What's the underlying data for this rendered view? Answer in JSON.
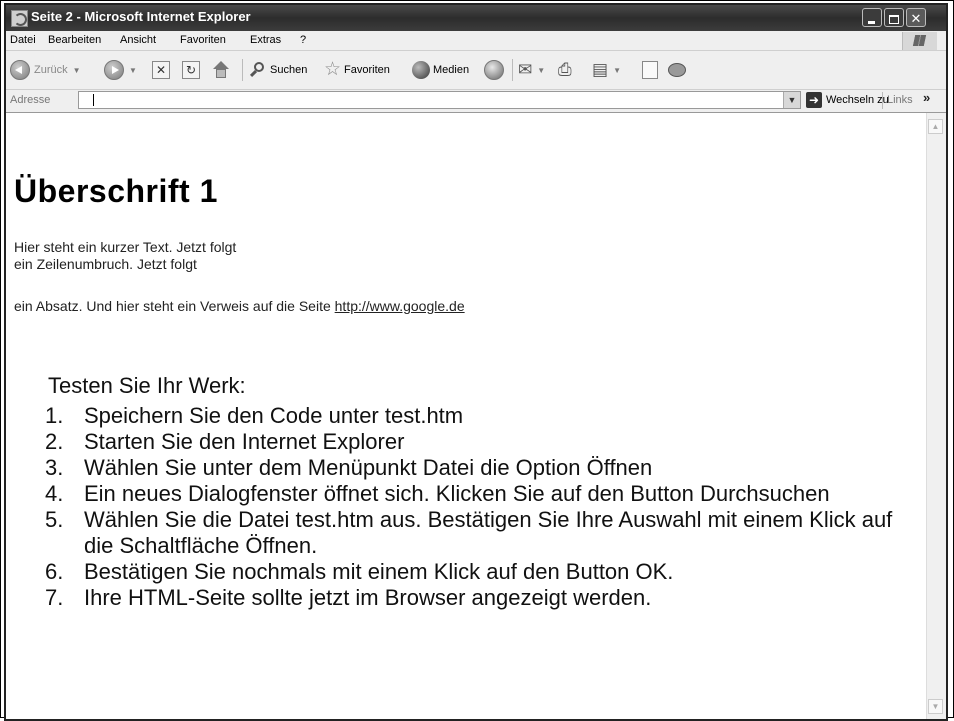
{
  "window": {
    "title": "Seite 2 - Microsoft Internet Explorer"
  },
  "menu": {
    "items": [
      "Datei",
      "Bearbeiten",
      "Ansicht",
      "Favoriten",
      "Extras",
      "?"
    ]
  },
  "toolbar": {
    "back_label": "Zurück",
    "search_label": "Suchen",
    "favorites_label": "Favoriten",
    "media_label": "Medien"
  },
  "address": {
    "label": "Adresse",
    "value": "",
    "go_label": "Wechseln zu",
    "links_label": "Links"
  },
  "page": {
    "heading": "Überschrift 1",
    "line1": "Hier steht ein kurzer Text. Jetzt folgt",
    "line2": "ein Zeilenumbruch. Jetzt folgt",
    "para_text": "ein Absatz. Und hier steht ein Verweis auf die Seite ",
    "link_text": "http://www.google.de"
  },
  "instructions": {
    "heading": "Testen Sie Ihr Werk:",
    "steps": [
      {
        "num": "1.",
        "text": "Speichern Sie den Code unter test.htm"
      },
      {
        "num": "2.",
        "text": "Starten Sie den Internet Explorer"
      },
      {
        "num": "3.",
        "text": "Wählen Sie unter dem Menüpunkt Datei die Option Öffnen"
      },
      {
        "num": "4.",
        "text": "Ein neues Dialogfenster öffnet sich. Klicken Sie auf den Button Durchsuchen"
      },
      {
        "num": "5.",
        "text": "Wählen Sie die Datei test.htm aus. Bestätigen Sie Ihre Auswahl mit einem Klick auf die Schaltfläche Öffnen."
      },
      {
        "num": "6.",
        "text": "Bestätigen Sie nochmals mit einem Klick auf den Button OK."
      },
      {
        "num": "7.",
        "text": "Ihre HTML-Seite sollte jetzt im Browser angezeigt werden."
      }
    ]
  }
}
